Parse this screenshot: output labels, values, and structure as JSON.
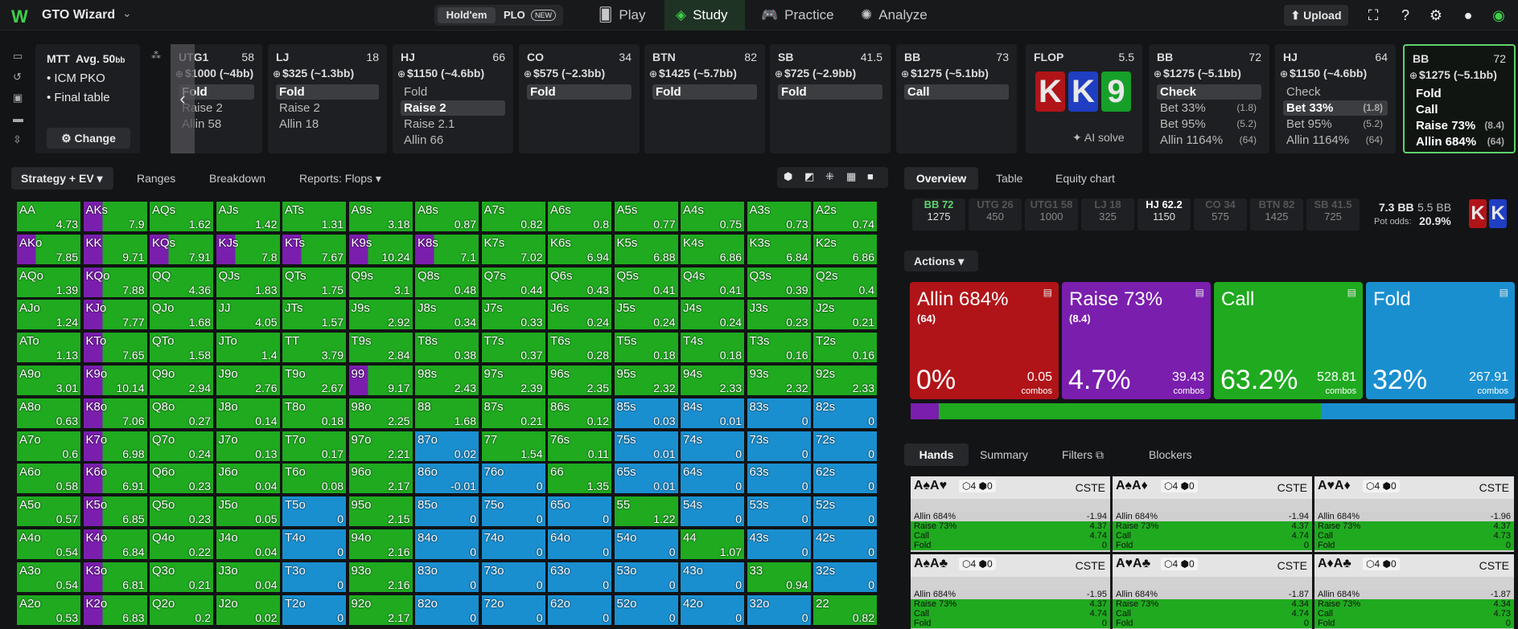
{
  "app": {
    "title": "GTO Wizard",
    "game_tabs": [
      "Hold'em",
      "PLO"
    ],
    "new_badge": "NEW",
    "nav": [
      "Play",
      "Study",
      "Practice",
      "Analyze"
    ],
    "upload": "Upload"
  },
  "colors": {
    "allin": "#b01418",
    "raise": "#7a1eae",
    "call": "#1faa1f",
    "fold": "#1a8fd0",
    "accent": "#3ecf4a"
  },
  "mtt": {
    "line1": "MTT",
    "avg": "Avg. 50",
    "avg_unit": "bb",
    "items": [
      "ICM PKO",
      "Final table"
    ],
    "change": "Change"
  },
  "cards": [
    {
      "pos": "UTG1",
      "bb": "58",
      "stack": "$1000 (~4bb)",
      "actions": [
        {
          "t": "Fold",
          "sel": true
        },
        {
          "t": "Raise 2",
          "sel": false
        },
        {
          "t": "Allin 58",
          "sel": false
        }
      ]
    },
    {
      "pos": "LJ",
      "bb": "18",
      "stack": "$325 (~1.3bb)",
      "actions": [
        {
          "t": "Fold",
          "sel": true
        },
        {
          "t": "Raise 2",
          "sel": false
        },
        {
          "t": "Allin 18",
          "sel": false
        }
      ]
    },
    {
      "pos": "HJ",
      "bb": "66",
      "stack": "$1150 (~4.6bb)",
      "actions": [
        {
          "t": "Fold",
          "sel": false
        },
        {
          "t": "Raise 2",
          "sel": true
        },
        {
          "t": "Raise 2.1",
          "sel": false
        },
        {
          "t": "Allin 66",
          "sel": false
        }
      ]
    },
    {
      "pos": "CO",
      "bb": "34",
      "stack": "$575 (~2.3bb)",
      "actions": [
        {
          "t": "Fold",
          "sel": true
        }
      ]
    },
    {
      "pos": "BTN",
      "bb": "82",
      "stack": "$1425 (~5.7bb)",
      "actions": [
        {
          "t": "Fold",
          "sel": true
        }
      ]
    },
    {
      "pos": "SB",
      "bb": "41.5",
      "stack": "$725 (~2.9bb)",
      "actions": [
        {
          "t": "Fold",
          "sel": true
        }
      ]
    },
    {
      "pos": "BB",
      "bb": "73",
      "stack": "$1275 (~5.1bb)",
      "actions": [
        {
          "t": "Call",
          "sel": true
        }
      ]
    }
  ],
  "flop": {
    "label": "FLOP",
    "pot": "5.5",
    "cards": [
      "K",
      "K",
      "9"
    ],
    "ai": "AI solve"
  },
  "post": [
    {
      "pos": "BB",
      "bb": "72",
      "stack": "$1275 (~5.1bb)",
      "actions": [
        {
          "t": "Check",
          "n": "",
          "sel": true
        },
        {
          "t": "Bet 33%",
          "n": "(1.8)",
          "sel": false
        },
        {
          "t": "Bet 95%",
          "n": "(5.2)",
          "sel": false
        },
        {
          "t": "Allin 1164%",
          "n": "(64)",
          "sel": false
        }
      ]
    },
    {
      "pos": "HJ",
      "bb": "64",
      "stack": "$1150 (~4.6bb)",
      "actions": [
        {
          "t": "Check",
          "n": "",
          "sel": false
        },
        {
          "t": "Bet 33%",
          "n": "(1.8)",
          "sel": true
        },
        {
          "t": "Bet 95%",
          "n": "(5.2)",
          "sel": false
        },
        {
          "t": "Allin 1164%",
          "n": "(64)",
          "sel": false
        }
      ]
    },
    {
      "pos": "BB",
      "bb": "72",
      "stack": "$1275 (~5.1bb)",
      "actions": [
        {
          "t": "Fold",
          "n": "",
          "sel": false
        },
        {
          "t": "Call",
          "n": "",
          "sel": false
        },
        {
          "t": "Raise 73%",
          "n": "(8.4)",
          "sel": false
        },
        {
          "t": "Allin 684%",
          "n": "(64)",
          "sel": false
        }
      ]
    }
  ],
  "left_tabs": [
    "Strategy + EV",
    "Ranges",
    "Breakdown",
    "Reports: Flops"
  ],
  "right_tabs": [
    "Overview",
    "Table",
    "Equity chart"
  ],
  "positions": [
    {
      "p": "BB 72",
      "s": "1275"
    },
    {
      "p": "UTG 26",
      "s": "450"
    },
    {
      "p": "UTG1 58",
      "s": "1000"
    },
    {
      "p": "LJ 18",
      "s": "325"
    },
    {
      "p": "HJ 62.2",
      "s": "1150"
    },
    {
      "p": "CO 34",
      "s": "575"
    },
    {
      "p": "BTN 82",
      "s": "1425"
    },
    {
      "p": "SB 41.5",
      "s": "725"
    }
  ],
  "pot": {
    "bb1": "7.3 BB",
    "bb2": "5.5 BB",
    "odds_label": "Pot odds:",
    "odds": "20.9%"
  },
  "actions_label": "Actions",
  "action_boxes": [
    {
      "name": "Allin 684%",
      "sub": "(64)",
      "pct": "0%",
      "combos": "0.05",
      "cl": "combos",
      "color": "#b01418"
    },
    {
      "name": "Raise 73%",
      "sub": "(8.4)",
      "pct": "4.7%",
      "combos": "39.43",
      "cl": "combos",
      "color": "#7a1eae"
    },
    {
      "name": "Call",
      "sub": "",
      "pct": "63.2%",
      "combos": "528.81",
      "cl": "combos",
      "color": "#1faa1f"
    },
    {
      "name": "Fold",
      "sub": "",
      "pct": "32%",
      "combos": "267.91",
      "cl": "combos",
      "color": "#1a8fd0"
    }
  ],
  "freq_bar": {
    "allin": 0.0,
    "raise": 0.047,
    "call": 0.632,
    "fold": 0.32
  },
  "hand_tabs": [
    "Hands",
    "Summary",
    "Filters",
    "Blockers"
  ],
  "hand_cells": [
    {
      "cards": "A♠A♥",
      "cste": "CSTE",
      "rows": [
        [
          "Allin 684%",
          "-1.94"
        ],
        [
          "Raise 73%",
          "4.37"
        ],
        [
          "Call",
          "4.74"
        ],
        [
          "Fold",
          "0"
        ]
      ]
    },
    {
      "cards": "A♠A♦",
      "cste": "CSTE",
      "rows": [
        [
          "Allin 684%",
          "-1.94"
        ],
        [
          "Raise 73%",
          "4.37"
        ],
        [
          "Call",
          "4.74"
        ],
        [
          "Fold",
          "0"
        ]
      ]
    },
    {
      "cards": "A♥A♦",
      "cste": "CSTE",
      "rows": [
        [
          "Allin 684%",
          "-1.96"
        ],
        [
          "Raise 73%",
          "4.37"
        ],
        [
          "Call",
          "4.73"
        ],
        [
          "Fold",
          "0"
        ]
      ]
    },
    {
      "cards": "A♠A♣",
      "cste": "CSTE",
      "rows": [
        [
          "Allin 684%",
          "-1.95"
        ],
        [
          "Raise 73%",
          "4.37"
        ],
        [
          "Call",
          "4.74"
        ],
        [
          "Fold",
          "0"
        ]
      ]
    },
    {
      "cards": "A♥A♣",
      "cste": "CSTE",
      "rows": [
        [
          "Allin 684%",
          "-1.87"
        ],
        [
          "Raise 73%",
          "4.34"
        ],
        [
          "Call",
          "4.74"
        ],
        [
          "Fold",
          "0"
        ]
      ]
    },
    {
      "cards": "A♦A♣",
      "cste": "CSTE",
      "rows": [
        [
          "Allin 684%",
          "-1.87"
        ],
        [
          "Raise 73%",
          "4.34"
        ],
        [
          "Call",
          "4.73"
        ],
        [
          "Fold",
          "0"
        ]
      ]
    }
  ],
  "grid": [
    [
      [
        "AA",
        "4.73",
        "c"
      ],
      [
        "AKs",
        "7.9",
        "r"
      ],
      [
        "AQs",
        "1.62",
        "c"
      ],
      [
        "AJs",
        "1.42",
        "c"
      ],
      [
        "ATs",
        "1.31",
        "c"
      ],
      [
        "A9s",
        "3.18",
        "c"
      ],
      [
        "A8s",
        "0.87",
        "c"
      ],
      [
        "A7s",
        "0.82",
        "c"
      ],
      [
        "A6s",
        "0.8",
        "c"
      ],
      [
        "A5s",
        "0.77",
        "c"
      ],
      [
        "A4s",
        "0.75",
        "c"
      ],
      [
        "A3s",
        "0.73",
        "c"
      ],
      [
        "A2s",
        "0.74",
        "c"
      ]
    ],
    [
      [
        "AKo",
        "7.85",
        "r"
      ],
      [
        "KK",
        "9.71",
        "r"
      ],
      [
        "KQs",
        "7.91",
        "r"
      ],
      [
        "KJs",
        "7.8",
        "r"
      ],
      [
        "KTs",
        "7.67",
        "r"
      ],
      [
        "K9s",
        "10.24",
        "r"
      ],
      [
        "K8s",
        "7.1",
        "r"
      ],
      [
        "K7s",
        "7.02",
        "c"
      ],
      [
        "K6s",
        "6.94",
        "c"
      ],
      [
        "K5s",
        "6.88",
        "c"
      ],
      [
        "K4s",
        "6.86",
        "c"
      ],
      [
        "K3s",
        "6.84",
        "c"
      ],
      [
        "K2s",
        "6.86",
        "c"
      ]
    ],
    [
      [
        "AQo",
        "1.39",
        "c"
      ],
      [
        "KQo",
        "7.88",
        "r"
      ],
      [
        "QQ",
        "4.36",
        "c"
      ],
      [
        "QJs",
        "1.83",
        "c"
      ],
      [
        "QTs",
        "1.75",
        "c"
      ],
      [
        "Q9s",
        "3.1",
        "c"
      ],
      [
        "Q8s",
        "0.48",
        "c"
      ],
      [
        "Q7s",
        "0.44",
        "c"
      ],
      [
        "Q6s",
        "0.43",
        "c"
      ],
      [
        "Q5s",
        "0.41",
        "c"
      ],
      [
        "Q4s",
        "0.41",
        "c"
      ],
      [
        "Q3s",
        "0.39",
        "c"
      ],
      [
        "Q2s",
        "0.4",
        "c"
      ]
    ],
    [
      [
        "AJo",
        "1.24",
        "c"
      ],
      [
        "KJo",
        "7.77",
        "r"
      ],
      [
        "QJo",
        "1.68",
        "c"
      ],
      [
        "JJ",
        "4.05",
        "c"
      ],
      [
        "JTs",
        "1.57",
        "c"
      ],
      [
        "J9s",
        "2.92",
        "c"
      ],
      [
        "J8s",
        "0.34",
        "c"
      ],
      [
        "J7s",
        "0.33",
        "c"
      ],
      [
        "J6s",
        "0.24",
        "c"
      ],
      [
        "J5s",
        "0.24",
        "c"
      ],
      [
        "J4s",
        "0.24",
        "c"
      ],
      [
        "J3s",
        "0.23",
        "c"
      ],
      [
        "J2s",
        "0.21",
        "c"
      ]
    ],
    [
      [
        "ATo",
        "1.13",
        "c"
      ],
      [
        "KTo",
        "7.65",
        "r"
      ],
      [
        "QTo",
        "1.58",
        "c"
      ],
      [
        "JTo",
        "1.4",
        "c"
      ],
      [
        "TT",
        "3.79",
        "c"
      ],
      [
        "T9s",
        "2.84",
        "c"
      ],
      [
        "T8s",
        "0.38",
        "c"
      ],
      [
        "T7s",
        "0.37",
        "c"
      ],
      [
        "T6s",
        "0.28",
        "c"
      ],
      [
        "T5s",
        "0.18",
        "c"
      ],
      [
        "T4s",
        "0.18",
        "c"
      ],
      [
        "T3s",
        "0.16",
        "c"
      ],
      [
        "T2s",
        "0.16",
        "c"
      ]
    ],
    [
      [
        "A9o",
        "3.01",
        "c"
      ],
      [
        "K9o",
        "10.14",
        "r"
      ],
      [
        "Q9o",
        "2.94",
        "c"
      ],
      [
        "J9o",
        "2.76",
        "c"
      ],
      [
        "T9o",
        "2.67",
        "c"
      ],
      [
        "99",
        "9.17",
        "r"
      ],
      [
        "98s",
        "2.43",
        "c"
      ],
      [
        "97s",
        "2.39",
        "c"
      ],
      [
        "96s",
        "2.35",
        "c"
      ],
      [
        "95s",
        "2.32",
        "c"
      ],
      [
        "94s",
        "2.33",
        "c"
      ],
      [
        "93s",
        "2.32",
        "c"
      ],
      [
        "92s",
        "2.33",
        "c"
      ]
    ],
    [
      [
        "A8o",
        "0.63",
        "c"
      ],
      [
        "K8o",
        "7.06",
        "r"
      ],
      [
        "Q8o",
        "0.27",
        "c"
      ],
      [
        "J8o",
        "0.14",
        "c"
      ],
      [
        "T8o",
        "0.18",
        "c"
      ],
      [
        "98o",
        "2.25",
        "c"
      ],
      [
        "88",
        "1.68",
        "c"
      ],
      [
        "87s",
        "0.21",
        "c"
      ],
      [
        "86s",
        "0.12",
        "c"
      ],
      [
        "85s",
        "0.03",
        "f"
      ],
      [
        "84s",
        "0.01",
        "f"
      ],
      [
        "83s",
        "0",
        "f"
      ],
      [
        "82s",
        "0",
        "f"
      ]
    ],
    [
      [
        "A7o",
        "0.6",
        "c"
      ],
      [
        "K7o",
        "6.98",
        "r"
      ],
      [
        "Q7o",
        "0.24",
        "c"
      ],
      [
        "J7o",
        "0.13",
        "c"
      ],
      [
        "T7o",
        "0.17",
        "c"
      ],
      [
        "97o",
        "2.21",
        "c"
      ],
      [
        "87o",
        "0.02",
        "f"
      ],
      [
        "77",
        "1.54",
        "c"
      ],
      [
        "76s",
        "0.11",
        "c"
      ],
      [
        "75s",
        "0.01",
        "f"
      ],
      [
        "74s",
        "0",
        "f"
      ],
      [
        "73s",
        "0",
        "f"
      ],
      [
        "72s",
        "0",
        "f"
      ]
    ],
    [
      [
        "A6o",
        "0.58",
        "c"
      ],
      [
        "K6o",
        "6.91",
        "r"
      ],
      [
        "Q6o",
        "0.23",
        "c"
      ],
      [
        "J6o",
        "0.04",
        "c"
      ],
      [
        "T6o",
        "0.08",
        "c"
      ],
      [
        "96o",
        "2.17",
        "c"
      ],
      [
        "86o",
        "-0.01",
        "f"
      ],
      [
        "76o",
        "0",
        "f"
      ],
      [
        "66",
        "1.35",
        "c"
      ],
      [
        "65s",
        "0.01",
        "f"
      ],
      [
        "64s",
        "0",
        "f"
      ],
      [
        "63s",
        "0",
        "f"
      ],
      [
        "62s",
        "0",
        "f"
      ]
    ],
    [
      [
        "A5o",
        "0.57",
        "c"
      ],
      [
        "K5o",
        "6.85",
        "r"
      ],
      [
        "Q5o",
        "0.23",
        "c"
      ],
      [
        "J5o",
        "0.05",
        "c"
      ],
      [
        "T5o",
        "0",
        "f"
      ],
      [
        "95o",
        "2.15",
        "c"
      ],
      [
        "85o",
        "0",
        "f"
      ],
      [
        "75o",
        "0",
        "f"
      ],
      [
        "65o",
        "0",
        "f"
      ],
      [
        "55",
        "1.22",
        "c"
      ],
      [
        "54s",
        "0",
        "f"
      ],
      [
        "53s",
        "0",
        "f"
      ],
      [
        "52s",
        "0",
        "f"
      ]
    ],
    [
      [
        "A4o",
        "0.54",
        "c"
      ],
      [
        "K4o",
        "6.84",
        "r"
      ],
      [
        "Q4o",
        "0.22",
        "c"
      ],
      [
        "J4o",
        "0.04",
        "c"
      ],
      [
        "T4o",
        "0",
        "f"
      ],
      [
        "94o",
        "2.16",
        "c"
      ],
      [
        "84o",
        "0",
        "f"
      ],
      [
        "74o",
        "0",
        "f"
      ],
      [
        "64o",
        "0",
        "f"
      ],
      [
        "54o",
        "0",
        "f"
      ],
      [
        "44",
        "1.07",
        "c"
      ],
      [
        "43s",
        "0",
        "f"
      ],
      [
        "42s",
        "0",
        "f"
      ]
    ],
    [
      [
        "A3o",
        "0.54",
        "c"
      ],
      [
        "K3o",
        "6.81",
        "r"
      ],
      [
        "Q3o",
        "0.21",
        "c"
      ],
      [
        "J3o",
        "0.04",
        "c"
      ],
      [
        "T3o",
        "0",
        "f"
      ],
      [
        "93o",
        "2.16",
        "c"
      ],
      [
        "83o",
        "0",
        "f"
      ],
      [
        "73o",
        "0",
        "f"
      ],
      [
        "63o",
        "0",
        "f"
      ],
      [
        "53o",
        "0",
        "f"
      ],
      [
        "43o",
        "0",
        "f"
      ],
      [
        "33",
        "0.94",
        "c"
      ],
      [
        "32s",
        "0",
        "f"
      ]
    ],
    [
      [
        "A2o",
        "0.53",
        "c"
      ],
      [
        "K2o",
        "6.83",
        "r"
      ],
      [
        "Q2o",
        "0.2",
        "c"
      ],
      [
        "J2o",
        "0.02",
        "c"
      ],
      [
        "T2o",
        "0",
        "f"
      ],
      [
        "92o",
        "2.17",
        "c"
      ],
      [
        "82o",
        "0",
        "f"
      ],
      [
        "72o",
        "0",
        "f"
      ],
      [
        "62o",
        "0",
        "f"
      ],
      [
        "52o",
        "0",
        "f"
      ],
      [
        "42o",
        "0",
        "f"
      ],
      [
        "32o",
        "0",
        "f"
      ],
      [
        "22",
        "0.82",
        "c"
      ]
    ]
  ]
}
